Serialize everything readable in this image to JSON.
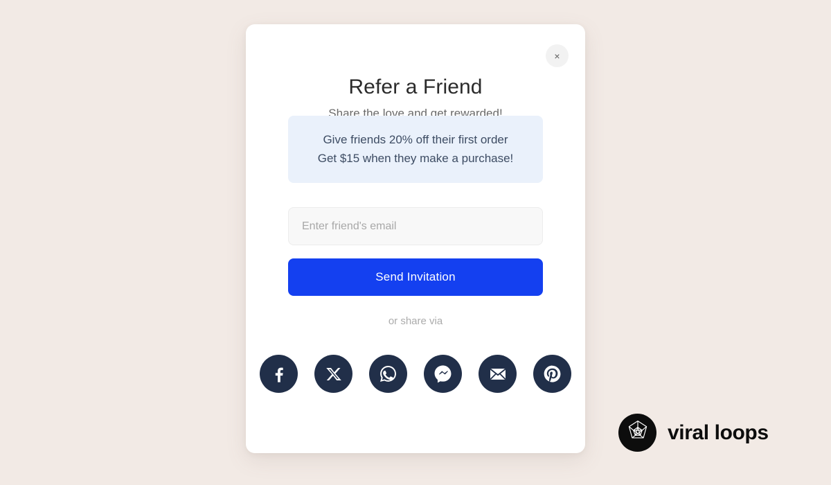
{
  "background_color": "#f2eae5",
  "modal": {
    "title": "Refer a Friend",
    "subtitle": "Share the love and get rewarded!",
    "close_label": "×",
    "close_icon": "close-icon",
    "card_color": "#ffffff",
    "reward": {
      "background_color": "#eaf1fb",
      "text_color": "#3d4c63",
      "lines": [
        "Give friends 20% off their first order",
        "Get $15 when they make a purchase!"
      ]
    },
    "email_field": {
      "placeholder": "Enter friend's email",
      "value": ""
    },
    "submit": {
      "label": "Send Invitation",
      "color": "#1440f0"
    },
    "share": {
      "label": "or share via",
      "icon_color": "#212f49",
      "items": [
        {
          "name": "facebook",
          "icon": "facebook-icon"
        },
        {
          "name": "x",
          "icon": "x-twitter-icon"
        },
        {
          "name": "whatsapp",
          "icon": "whatsapp-icon"
        },
        {
          "name": "messenger",
          "icon": "messenger-icon"
        },
        {
          "name": "email",
          "icon": "email-icon"
        },
        {
          "name": "pinterest",
          "icon": "pinterest-icon"
        }
      ]
    }
  },
  "brand": {
    "name": "viral loops",
    "mark_icon": "icosahedron-icon",
    "mark_color": "#0d0d0d"
  }
}
